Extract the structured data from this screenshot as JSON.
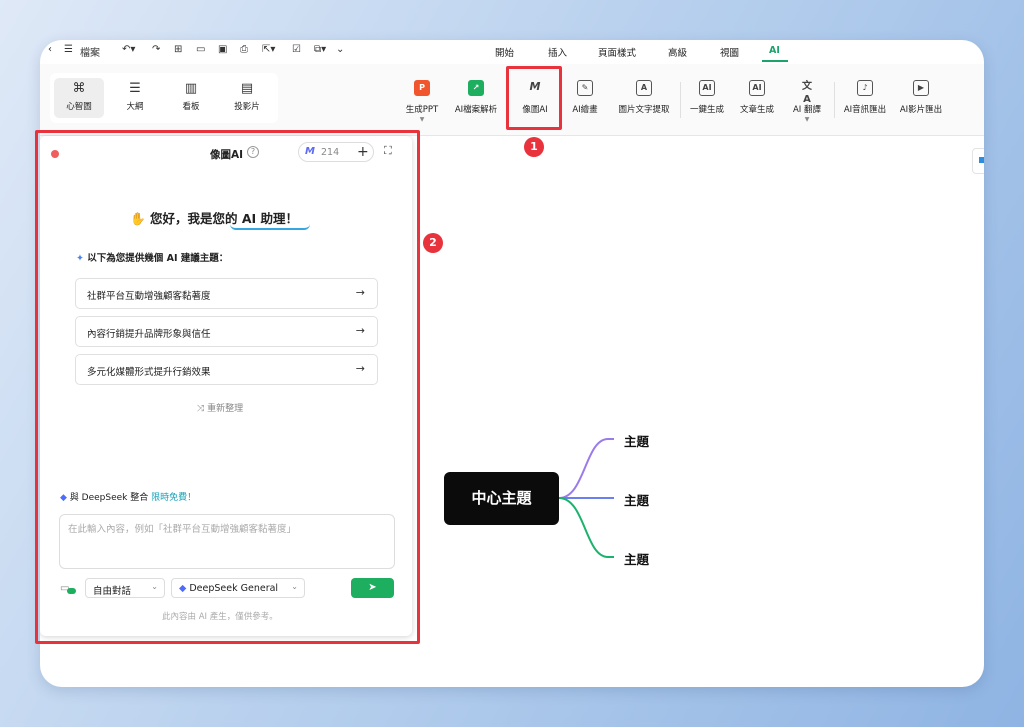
{
  "menubar": {
    "file_label": "檔案",
    "tabs": [
      {
        "label": "開始",
        "active": false
      },
      {
        "label": "插入",
        "active": false
      },
      {
        "label": "頁面樣式",
        "active": false
      },
      {
        "label": "高級",
        "active": false
      },
      {
        "label": "視圖",
        "active": false
      },
      {
        "label": "AI",
        "active": true
      }
    ]
  },
  "views": [
    {
      "label": "心智圖",
      "icon": "mindmap-icon",
      "active": true
    },
    {
      "label": "大綱",
      "icon": "outline-icon",
      "active": false
    },
    {
      "label": "看板",
      "icon": "kanban-icon",
      "active": false
    },
    {
      "label": "投影片",
      "icon": "slides-icon",
      "active": false
    }
  ],
  "tools": [
    {
      "label": "生成PPT",
      "icon": "ppt-icon",
      "has_dropdown": true
    },
    {
      "label": "AI檔案解析",
      "icon": "document-parse-icon",
      "has_dropdown": false
    },
    {
      "label": "像圖AI",
      "icon": "xiangtu-ai-icon",
      "has_dropdown": false
    },
    {
      "label": "AI繪畫",
      "icon": "ai-paint-icon",
      "has_dropdown": false
    },
    {
      "label": "圖片文字提取",
      "icon": "image-text-extract-icon",
      "has_dropdown": false
    },
    {
      "label": "一鍵生成",
      "icon": "one-click-generate-icon",
      "has_dropdown": false
    },
    {
      "label": "文章生成",
      "icon": "article-generate-icon",
      "has_dropdown": false
    },
    {
      "label": "AI 翻譯",
      "icon": "translate-icon",
      "has_dropdown": true
    },
    {
      "label": "AI音訊匯出",
      "icon": "audio-export-icon",
      "has_dropdown": false
    },
    {
      "label": "AI影片匯出",
      "icon": "video-export-icon",
      "has_dropdown": false
    }
  ],
  "annotations": {
    "badge_1": "1",
    "badge_2": "2",
    "highlight_color": "#e8323c"
  },
  "panel": {
    "title": "像圖AI",
    "help": "?",
    "credits": "214",
    "greeting_prefix": "您好，我是您的",
    "greeting_emphasis": "AI 助理",
    "greeting_suffix": "！",
    "suggest_heading": "以下為您提供幾個 AI 建議主題：",
    "suggestions": [
      "社群平台互動增強顧客黏著度",
      "內容行銷提升品牌形象與信任",
      "多元化媒體形式提升行銷效果"
    ],
    "refresh_label": "重新整理",
    "deepseek_prefix": "與 DeepSeek 整合",
    "deepseek_free": "限時免費！",
    "input_placeholder": "在此輸入內容，例如「社群平台互動增強顧客黏著度」",
    "mode_select": "自由對話",
    "model_select": "DeepSeek General",
    "disclaimer": "此內容由 AI 產生，僅供參考。"
  },
  "mindmap": {
    "central": "中心主題",
    "topics": [
      "主題",
      "主題",
      "主題"
    ],
    "branch_colors": [
      "#9b7bea",
      "#6b7ff0",
      "#19b36c"
    ]
  },
  "colors": {
    "accent": "#1aa36b",
    "highlight": "#e8323c"
  }
}
